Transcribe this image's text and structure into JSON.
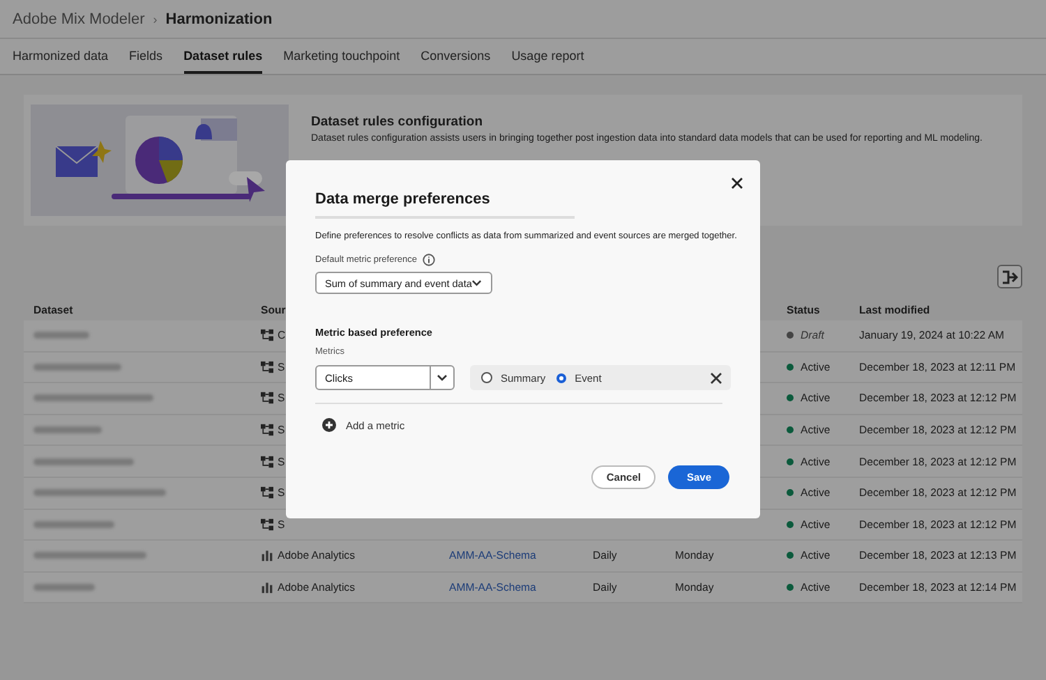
{
  "breadcrumb": {
    "parent": "Adobe Mix Modeler",
    "separator": "›",
    "current": "Harmonization"
  },
  "tabs": [
    {
      "label": "Harmonized data",
      "selected": false
    },
    {
      "label": "Fields",
      "selected": false
    },
    {
      "label": "Dataset rules",
      "selected": true
    },
    {
      "label": "Marketing touchpoint",
      "selected": false
    },
    {
      "label": "Conversions",
      "selected": false
    },
    {
      "label": "Usage report",
      "selected": false
    }
  ],
  "banner": {
    "title": "Dataset rules configuration",
    "description": "Dataset rules configuration assists users in bringing together post ingestion data into standard data models that can be used for reporting and ML modeling."
  },
  "table": {
    "columns": [
      {
        "label": "Dataset"
      },
      {
        "label": "Sour"
      },
      {
        "label": "Status"
      },
      {
        "label": "Last modified"
      }
    ],
    "rows": [
      {
        "kind": "merge",
        "source": "C",
        "status": "Draft",
        "draft": true,
        "color": "#444444",
        "modified": "January 19, 2024 at 10:22 AM"
      },
      {
        "kind": "merge",
        "source": "S",
        "status": "Active",
        "draft": false,
        "color": "#0b5a3c",
        "modified": "December 18, 2023 at 12:11 PM"
      },
      {
        "kind": "merge",
        "source": "S",
        "status": "Active",
        "draft": false,
        "color": "#0b5a3c",
        "modified": "December 18, 2023 at 12:12 PM"
      },
      {
        "kind": "merge",
        "source": "S",
        "status": "Active",
        "draft": false,
        "color": "#0b5a3c",
        "modified": "December 18, 2023 at 12:12 PM"
      },
      {
        "kind": "merge",
        "source": "S",
        "status": "Active",
        "draft": false,
        "color": "#0b5a3c",
        "modified": "December 18, 2023 at 12:12 PM"
      },
      {
        "kind": "merge",
        "source": "S",
        "status": "Active",
        "draft": false,
        "color": "#0b5a3c",
        "modified": "December 18, 2023 at 12:12 PM"
      },
      {
        "kind": "merge",
        "source": "S",
        "status": "Active",
        "draft": false,
        "color": "#0b5a3c",
        "modified": "December 18, 2023 at 12:12 PM"
      },
      {
        "kind": "analytics",
        "source": "Adobe Analytics",
        "schema": "AMM-AA-Schema",
        "frequency": "Daily",
        "day": "Monday",
        "status": "Active",
        "draft": false,
        "color": "#0b5a3c",
        "modified": "December 18, 2023 at 12:13 PM"
      },
      {
        "kind": "analytics",
        "source": "Adobe Analytics",
        "schema": "AMM-AA-Schema",
        "frequency": "Daily",
        "day": "Monday",
        "status": "Active",
        "draft": false,
        "color": "#0b5a3c",
        "modified": "December 18, 2023 at 12:14 PM"
      }
    ]
  },
  "dialog": {
    "title": "Data merge preferences",
    "description": "Define preferences to resolve conflicts as data from summarized and event sources are merged together.",
    "default_label": "Default metric preference",
    "default_value": "Sum of summary and event data",
    "section_title": "Metric based preference",
    "metrics_label": "Metrics",
    "metric_rules": [
      {
        "metric": "Clicks",
        "options": [
          {
            "label": "Summary",
            "selected": false
          },
          {
            "label": "Event",
            "selected": true
          }
        ]
      }
    ],
    "add_label": "Add a metric",
    "buttons": [
      {
        "label": "Cancel",
        "kind": "secondary"
      },
      {
        "label": "Save",
        "kind": "primary"
      }
    ]
  }
}
